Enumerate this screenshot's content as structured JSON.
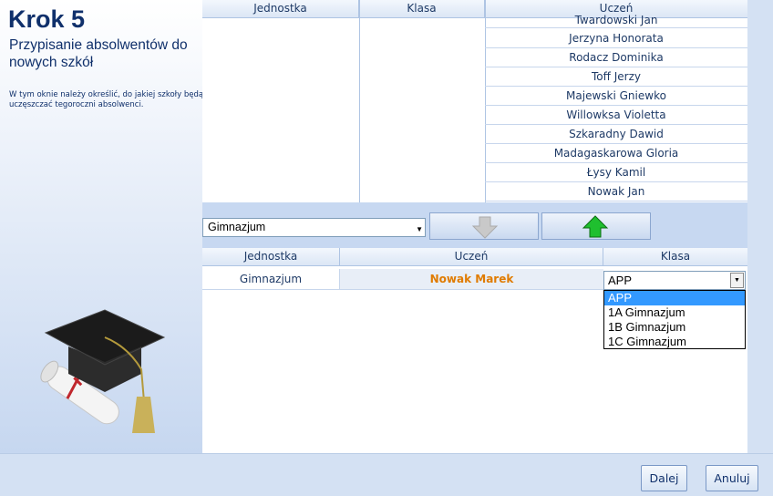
{
  "step": {
    "title": "Krok 5",
    "subtitle": "Przypisanie absolwentów do nowych szkół",
    "description": "W tym oknie należy określić, do jakiej szkoły będą uczęszczać tegoroczni absolwenci."
  },
  "upper_table": {
    "headers": [
      "Jednostka",
      "Klasa",
      "Uczeń"
    ],
    "students": [
      "Twardowski Jan",
      "Jerzyna Honorata",
      "Rodacz Dominika",
      "Toff Jerzy",
      "Majewski Gniewko",
      "Willowksa Violetta",
      "Szkaradny Dawid",
      "Madagaskarowa Gloria",
      "Łysy Kamil",
      "Nowak Jan"
    ]
  },
  "school_combo": {
    "value": "Gimnazjum"
  },
  "lower_table": {
    "headers": [
      "Jednostka",
      "Uczeń",
      "Klasa"
    ],
    "row": {
      "jednostka": "Gimnazjum",
      "uczen": "Nowak Marek",
      "klasa": "APP"
    }
  },
  "klasa_options": [
    "APP",
    "1A Gimnazjum",
    "1B Gimnazjum",
    "1C Gimnazjum"
  ],
  "buttons": {
    "next": "Dalej",
    "cancel": "Anuluj"
  },
  "icons": {
    "move_down": "arrow-down-icon",
    "move_up": "arrow-up-icon"
  },
  "colors": {
    "highlight_name": "#e07b00",
    "selection": "#3399ff"
  }
}
